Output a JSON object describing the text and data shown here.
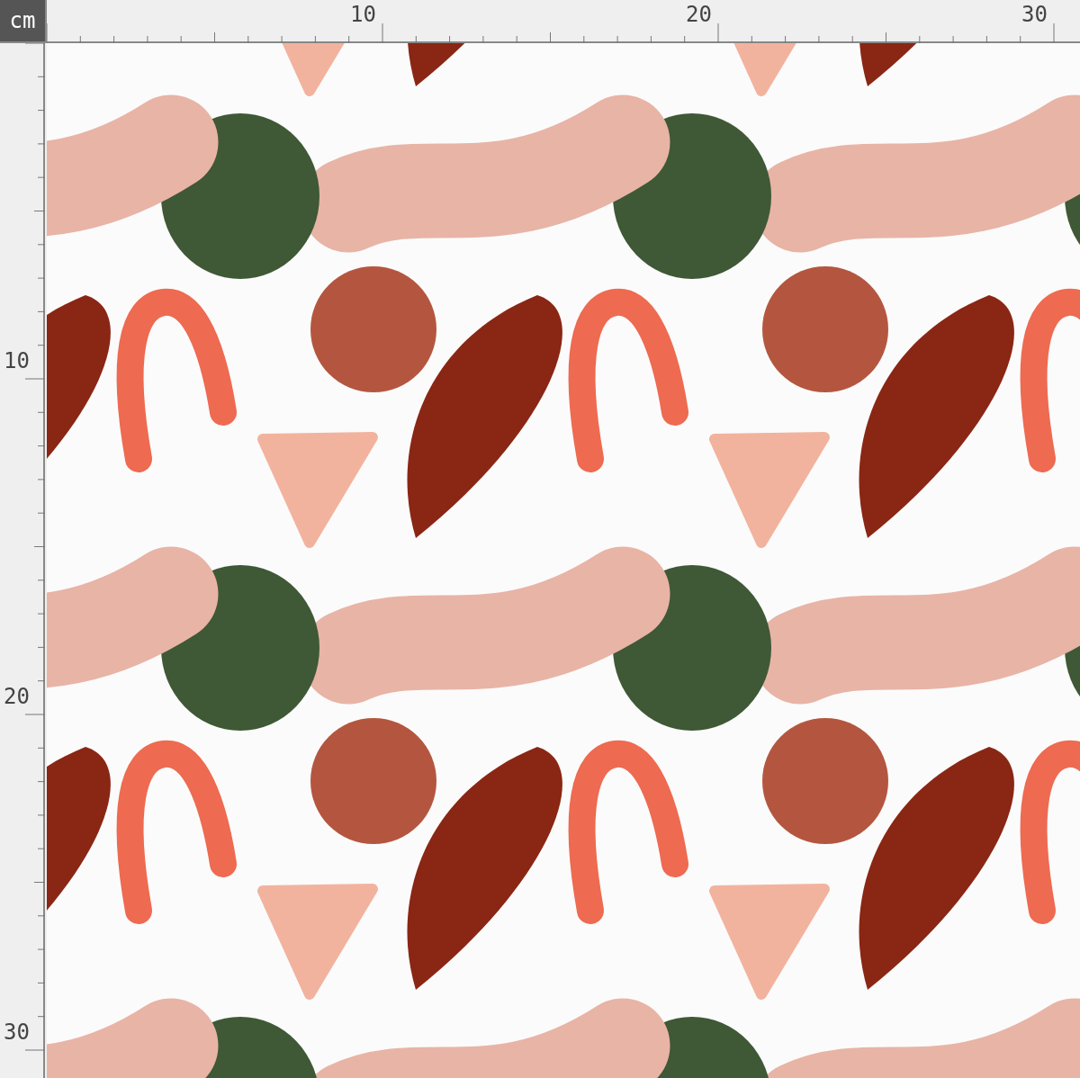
{
  "unit": "cm",
  "top_ruler": {
    "labels": [
      "10",
      "20",
      "30"
    ]
  },
  "left_ruler": {
    "labels": [
      "10",
      "20",
      "30"
    ]
  }
}
